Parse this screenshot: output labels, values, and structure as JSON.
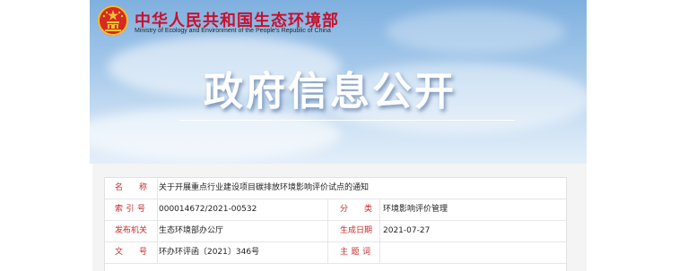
{
  "header": {
    "org_name_cn": "中华人民共和国生态环境部",
    "org_name_en": "Ministry of Ecology and Environment of the People's Republic of China",
    "banner_title": "政府信息公开"
  },
  "info": {
    "name_label": "名　　称",
    "name_value": "关于开展重点行业建设项目碳排放环境影响评价试点的通知",
    "index_label": "索 引 号",
    "index_value": "000014672/2021-00532",
    "category_label": "分　　类",
    "category_value": "环境影响评价管理",
    "issuer_label": "发布机关",
    "issuer_value": "生态环境部办公厅",
    "date_label": "生成日期",
    "date_value": "2021-07-27",
    "docno_label": "文　　号",
    "docno_value": "环办环评函〔2021〕346号",
    "subject_label": "主 题 词",
    "subject_value": ""
  },
  "colors": {
    "label_red": "#c42a2a",
    "brand_red": "#c8102e"
  }
}
